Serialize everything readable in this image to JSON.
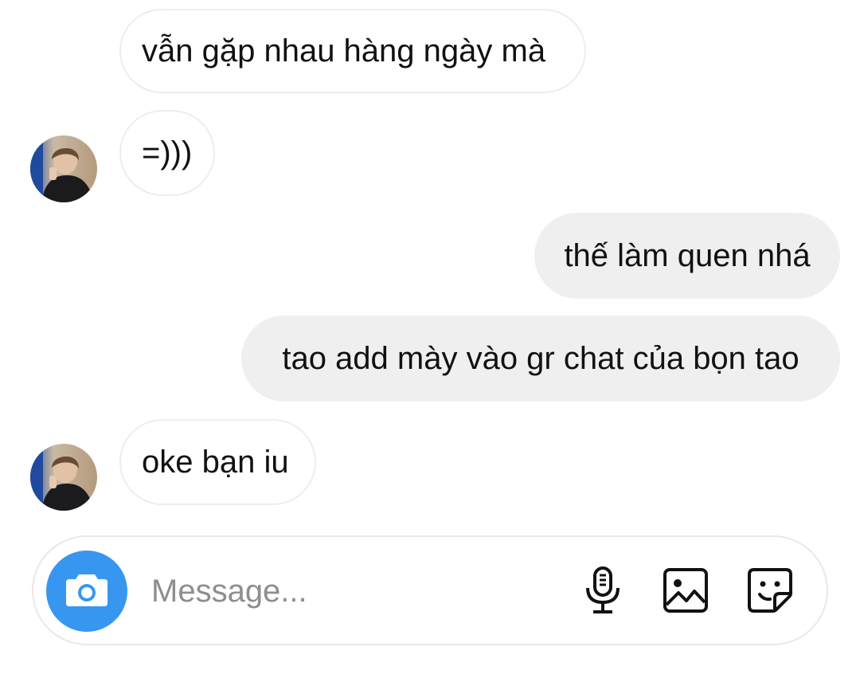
{
  "messages": [
    {
      "sender": "them",
      "text": "vẫn gặp nhau hàng ngày mà"
    },
    {
      "sender": "them",
      "text": "=)))"
    },
    {
      "sender": "me",
      "text": "thế làm quen nhá"
    },
    {
      "sender": "me",
      "text": "tao add mày vào gr chat của bọn tao"
    },
    {
      "sender": "them",
      "text": "oke bạn iu"
    }
  ],
  "composer": {
    "placeholder": "Message...",
    "value": "",
    "left_button_icon": "camera-icon",
    "right_icons": [
      "microphone-icon",
      "image-gallery-icon",
      "sticker-icon"
    ]
  },
  "colors": {
    "outgoing_bubble": "#efefef",
    "incoming_border": "#ededed",
    "camera_button": "#3797f0",
    "text": "#111111",
    "placeholder": "#8e8e8e"
  }
}
